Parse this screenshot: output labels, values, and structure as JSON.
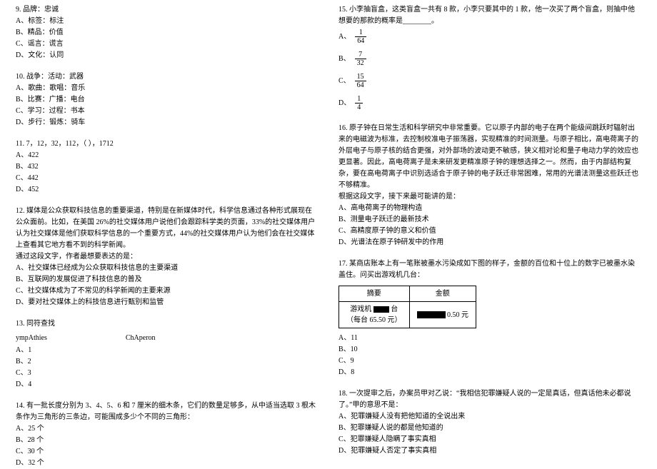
{
  "left": {
    "q9": {
      "title": "9. 品牌：忠诚",
      "opts": [
        "A、标签：标注",
        "B、精品：价值",
        "C、谣言：谎言",
        "D、文化：认同"
      ]
    },
    "q10": {
      "title": "10. 战争：活动：武器",
      "opts": [
        "A、歌曲：歌唱：音乐",
        "B、比赛：广播：电台",
        "C、学习：过程：书本",
        "D、步行：锻炼：骑车"
      ]
    },
    "q11": {
      "title": "11. 7，12，32，112，（   ），1712",
      "opts": [
        "A、422",
        "B、432",
        "C、442",
        "D、452"
      ]
    },
    "q12": {
      "title": "12. 媒体是公众获取科技信息的重要渠道，特别是在新媒体时代，科学信息通过各种形式展现在公众面前。比如，在美国 26%的社交媒体用户说他们会跟踪科学类的页面，33%的社交媒体用户认为社交媒体是他们获取科学信息的一个重要方式，44%的社交媒体用户认为他们会在社交媒体上查看其它地方看不到的科学新闻。",
      "sub": "通过这段文字，作者最想要表达的是：",
      "opts": [
        "A、社交媒体已经成为公众获取科技信息的主要渠道",
        "B、互联网的发展促进了科技信息的普及",
        "C、社交媒体成为了不常见的科学新闻的主要来源",
        "D、要对社交媒体上的科技信息进行甄别和监管"
      ]
    },
    "q13": {
      "title": "13. 同符查找",
      "words": [
        "ympAthies",
        "ChAperon"
      ],
      "opts": [
        "A、1",
        "B、2",
        "C、3",
        "D、4"
      ]
    },
    "q14": {
      "title": "14. 有一批长度分别为 3、4、5、6 和 7 厘米的细木条，它们的数量足够多，从中适当选取 3 根木条作为三角形的三条边，可能围成多少个不同的三角形：",
      "opts": [
        "A、25 个",
        "B、28 个",
        "C、30 个",
        "D、32 个"
      ]
    }
  },
  "right": {
    "q15": {
      "title": "15. 小李抽盲盒，这类盲盒一共有 8 款，小李只要其中的 1 款，他一次买了两个盲盒，则抽中他想要的那款的概率是________。",
      "opts": [
        {
          "label": "A、",
          "num": "1",
          "den": "64"
        },
        {
          "label": "B、",
          "num": "7",
          "den": "32"
        },
        {
          "label": "C、",
          "num": "15",
          "den": "64"
        },
        {
          "label": "D、",
          "num": "1",
          "den": "4"
        }
      ]
    },
    "q16": {
      "title": "16. 原子钟在日常生活和科学研究中非常重要。它以原子内部的电子在两个能级间跳跃时辐射出来的电磁波为标准，去控制校准电子振荡器，实现精准的时间测量。与原子相比，高电荷离子的外层电子与原子核的结合更强，对外部场的波动更不敏感，狭义相对论和量子电动力学的效应也更显著。因此，高电荷离子是未来研发更精准原子钟的理想选择之一。然而，由于内部结构复杂，要在高电荷离子中识别选适合于原子钟的电子跃迁非常困难，常用的光谱法测量这些跃迁也不够精准。",
      "sub": "根据这段文字，接下来最可能讲的是：",
      "opts": [
        "A、高电荷离子的物理构造",
        "B、测量电子跃迁的最新技术",
        "C、高精度原子钟的意义和价值",
        "D、光谱法在原子钟研发中的作用"
      ]
    },
    "q17": {
      "title": "17. 某商店账本上有一笔账被墨水污染成如下图的样子，金额的百位和十位上的数字已被墨水染盖住。问买出游戏机几台：",
      "table": {
        "h1": "摘要",
        "h2": "金额",
        "r1a": "游戏机",
        "r1b": "台",
        "r2": "（每台 65.50 元）",
        "r3": "0.50 元"
      },
      "opts": [
        "A、11",
        "B、10",
        "C、9",
        "D、8"
      ]
    },
    "q18": {
      "title": "18. 一次提审之后，办案员甲对乙说：“我相信犯罪嫌疑人说的一定是真话，但真话他未必都说了。”甲的意思不是：",
      "opts": [
        "A、犯罪嫌疑人没有把他知道的全说出来",
        "B、犯罪嫌疑人说的都是他知道的",
        "C、犯罪嫌疑人隐瞒了事实真相",
        "D、犯罪嫌疑人否定了事实真相"
      ]
    }
  }
}
